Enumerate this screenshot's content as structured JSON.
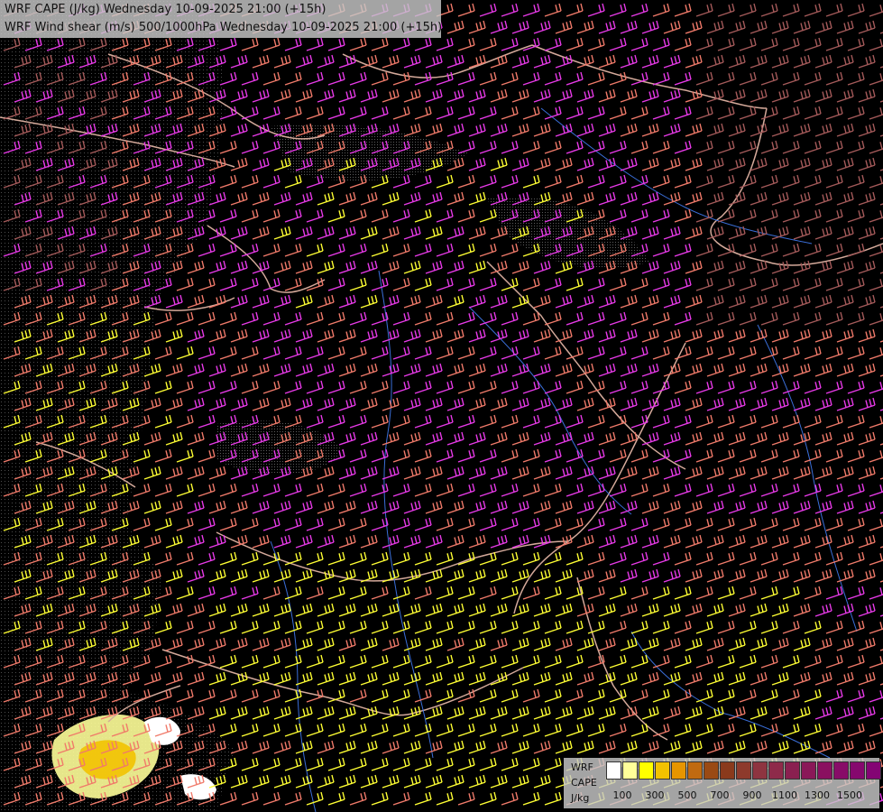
{
  "title": {
    "line1": "WRF CAPE (J/kg) Wednesday 10-09-2025 21:00 (+15h)",
    "line2": "WRF Wind shear (m/s) 500/1000hPa Wednesday 10-09-2025 21:00 (+15h)"
  },
  "legend": {
    "label_wrf": "WRF",
    "label_cape": "CAPE",
    "label_unit": "J/kg",
    "swatch_colors": [
      "#ffffff",
      "#ffff99",
      "#ffff00",
      "#f2c200",
      "#e69500",
      "#c06a10",
      "#9a4a14",
      "#8a3a1c",
      "#8e3a2c",
      "#8e3440",
      "#8e2a4a",
      "#8a2050",
      "#8a1858",
      "#8a1060",
      "#880c68",
      "#86086e",
      "#840474"
    ],
    "tick_labels": [
      "100",
      "300",
      "500",
      "700",
      "900",
      "1100",
      "1300",
      "1500"
    ]
  },
  "map": {
    "background_color": "#000000",
    "wind_barb_colors": {
      "yellow": "#ffff33",
      "salmon": "#f07a6a",
      "magenta": "#e83ae8",
      "muted_rose": "#a55a5a"
    },
    "border_color": "#d4a99a",
    "river_color": "#3a6ed8"
  }
}
